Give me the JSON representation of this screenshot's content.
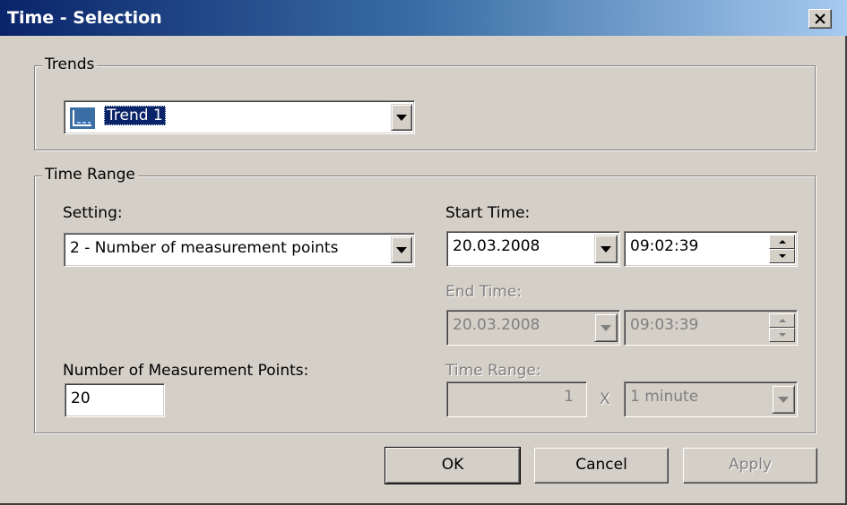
{
  "window": {
    "title": "Time - Selection"
  },
  "trends": {
    "group_label": "Trends",
    "selected": "Trend 1",
    "icon": "trend-chart-icon"
  },
  "time_range": {
    "group_label": "Time Range",
    "setting_label": "Setting:",
    "setting_value": "2 - Number of measurement points",
    "start_time_label": "Start Time:",
    "start_date": "20.03.2008",
    "start_time": "09:02:39",
    "end_time_label": "End Time:",
    "end_date": "20.03.2008",
    "end_time": "09:03:39",
    "num_points_label": "Number of Measurement Points:",
    "num_points_value": "20",
    "range_label": "Time Range:",
    "range_value": "1",
    "range_multiplier": "X",
    "range_unit": "1 minute"
  },
  "buttons": {
    "ok": "OK",
    "cancel": "Cancel",
    "apply": "Apply"
  },
  "colors": {
    "title_start": "#0a246a",
    "title_end": "#a6caf0",
    "face": "#d4d0c8",
    "disabled_text": "#808080"
  }
}
